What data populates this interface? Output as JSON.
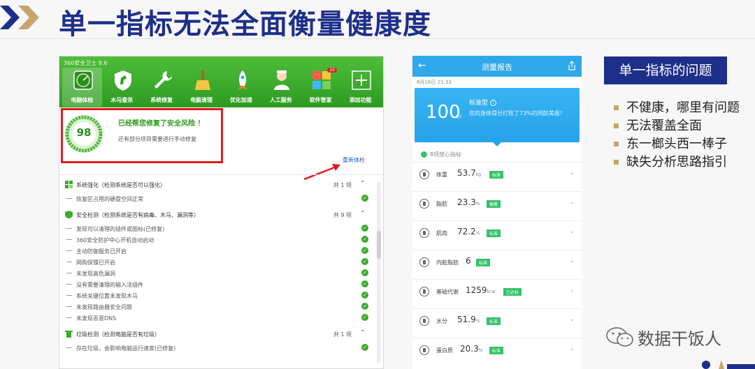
{
  "slide": {
    "title": "单一指标无法全面衡量健康度"
  },
  "app360": {
    "title": "360安全卫士 9.6",
    "toolbar": [
      {
        "label": "电脑体检",
        "icon": "radar-icon"
      },
      {
        "label": "木马查杀",
        "icon": "horse-shield-icon"
      },
      {
        "label": "系统修复",
        "icon": "wrench-icon"
      },
      {
        "label": "电脑清理",
        "icon": "broom-icon"
      },
      {
        "label": "优化加速",
        "icon": "rocket-icon"
      },
      {
        "label": "人工服务",
        "icon": "doctor-icon"
      },
      {
        "label": "软件管家",
        "icon": "apps-icon",
        "badge": "10"
      },
      {
        "label": "添加功能",
        "icon": "plus-icon"
      }
    ],
    "score": "98",
    "fix_title": "已经帮您修复了安全风险 ！",
    "fix_subtitle": "还有部分项目需要进行手动修复",
    "recheck_link": "重新体检",
    "sections": [
      {
        "title": "系统强化（检测系统是否可以强化）",
        "count": "共 1 项",
        "items": [
          "恢复区占用的硬盘空间正常"
        ]
      },
      {
        "title": "安全检测（检测系统是否有病毒、木马、漏洞等）",
        "count": "共 9 项",
        "items": [
          "发现可以清理的插件或图标(已修复)",
          "360安全防护中心开机自动启动",
          "主动防御服务已开启",
          "网购保镖已开启",
          "未发现高危漏洞",
          "没有需要清理的输入法插件",
          "系统关键位置未发现木马",
          "未发现路由器安全问题",
          "未发现恶意DNS"
        ]
      },
      {
        "title": "垃圾检测（检测电脑是否有垃圾）",
        "count": "共 1 项",
        "items": [
          "存在垃圾，会影响电脑运行速度(已修复)"
        ]
      }
    ]
  },
  "report": {
    "title": "测量报告",
    "date": "8月18日 21:33",
    "score": "100",
    "score_unit": "分",
    "body_type": "标准型",
    "description": "您的身体得分打败了73%的同龄美眉！",
    "section_label": "8项放心指标",
    "rows": [
      {
        "label": "体重",
        "value": "53.7",
        "unit": "kg",
        "tag": "标准"
      },
      {
        "label": "脂肪",
        "value": "23.3",
        "unit": "%",
        "tag": "偏瘦"
      },
      {
        "label": "肌肉",
        "value": "72.2",
        "unit": "%",
        "tag": "标准"
      },
      {
        "label": "内脏脂肪",
        "value": "6",
        "unit": "",
        "tag": "标准"
      },
      {
        "label": "基础代谢",
        "value": "1259",
        "unit": "kcal",
        "tag": "已达标"
      },
      {
        "label": "水分",
        "value": "51.9",
        "unit": "%",
        "tag": "标准"
      },
      {
        "label": "蛋白质",
        "value": "20.3",
        "unit": "%",
        "tag": "标准"
      }
    ]
  },
  "problems": {
    "heading": "单一指标的问题",
    "bullets": [
      "不健康，哪里有问题",
      "无法覆盖全面",
      "东一榔头西一棒子",
      "缺失分析思路指引"
    ]
  },
  "watermark": "数据干饭人",
  "colors": {
    "title_blue": "#1e2f8a",
    "green": "#3aab2b",
    "highlight_red": "#e01b1b",
    "phone_blue": "#2fa8ec",
    "bullet_gold": "#c8a56c"
  }
}
